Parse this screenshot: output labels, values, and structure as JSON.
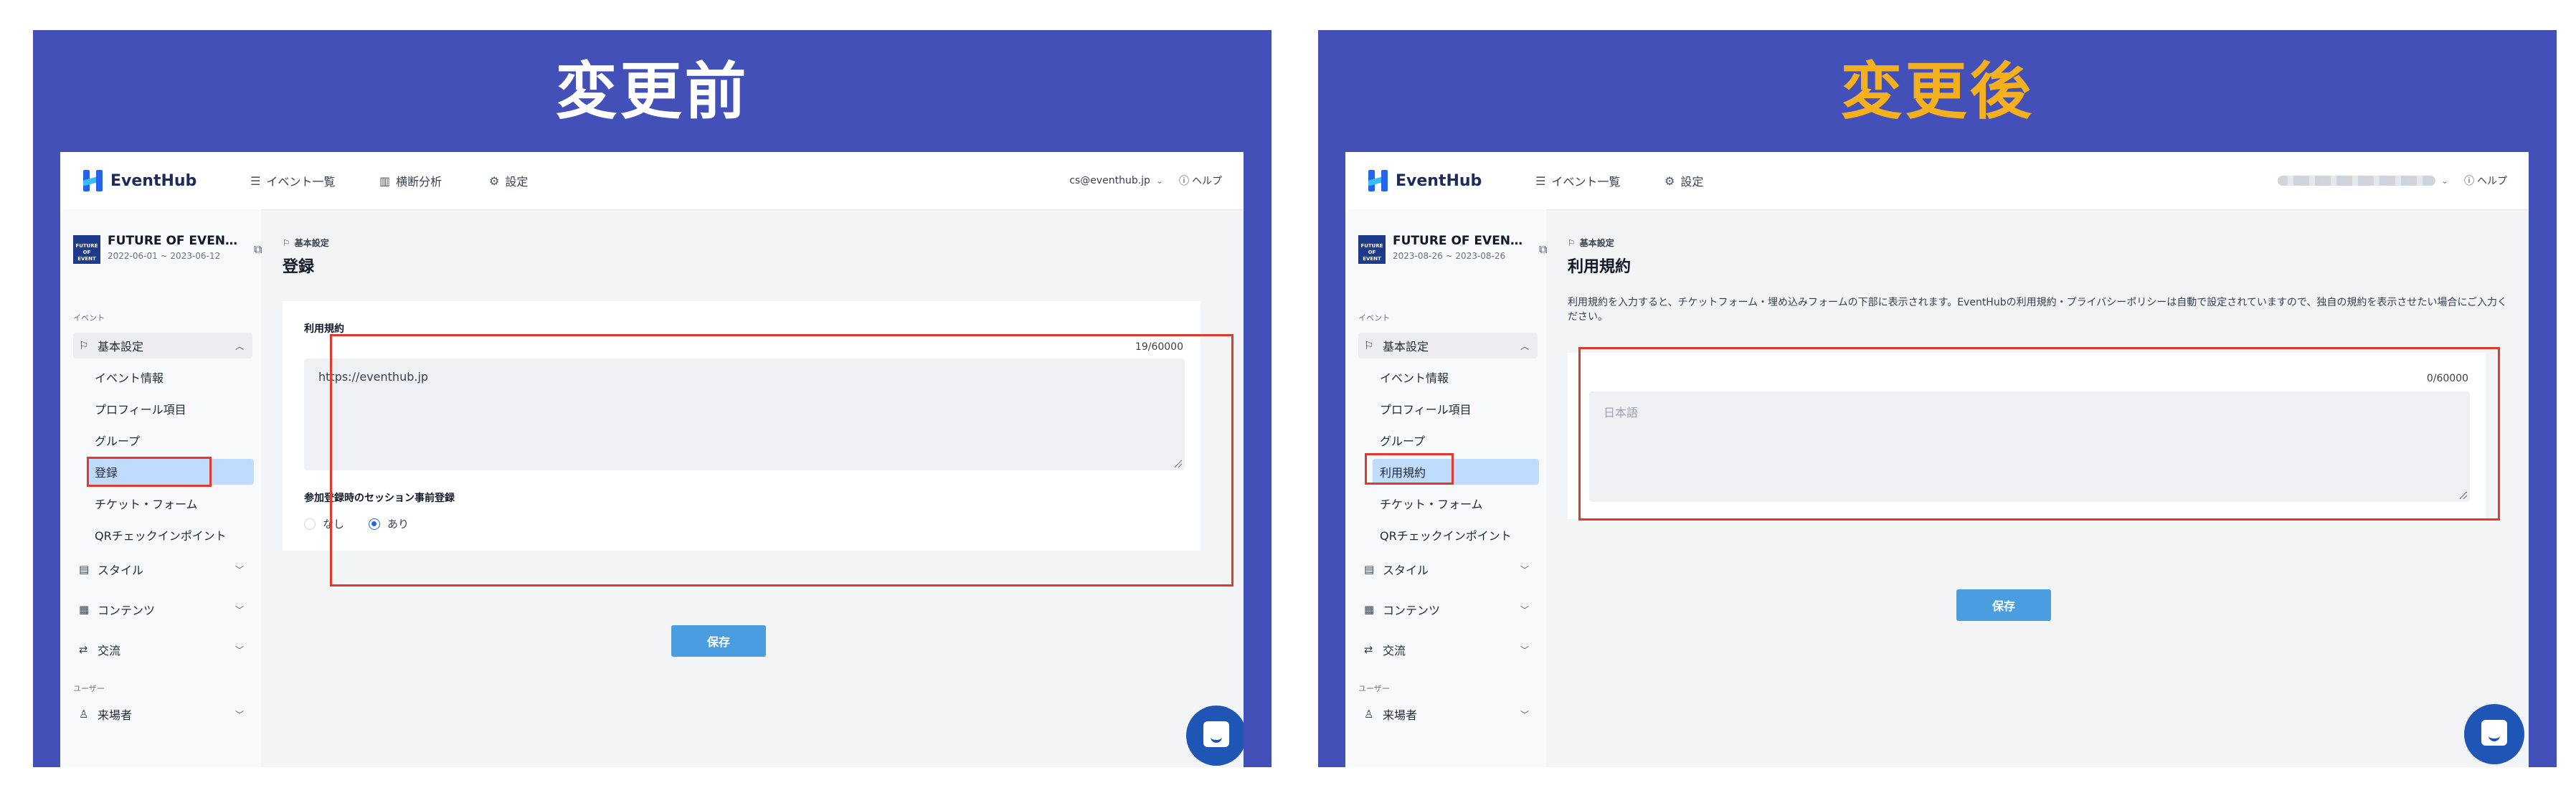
{
  "before": {
    "heading": "変更前",
    "app": {
      "logo": "EventHub",
      "nav": [
        {
          "icon": "list-icon",
          "label": "イベント一覧"
        },
        {
          "icon": "chart-icon",
          "label": "横断分析"
        },
        {
          "icon": "gear-icon",
          "label": "設定"
        }
      ],
      "account": "cs@eventhub.jp",
      "help": "ヘルプ",
      "event": {
        "name": "FUTURE OF EVEN…",
        "dates": "2022-06-01 ~ 2023-06-12",
        "thumb": "FUTURE OF EVENT"
      },
      "sidebar": {
        "section_event": "イベント",
        "group_basic": "基本設定",
        "sub_items": [
          "イベント情報",
          "プロフィール項目",
          "グループ",
          "登録",
          "チケット・フォーム",
          "QRチェックインポイント"
        ],
        "active_index": 3,
        "style": "スタイル",
        "contents": "コンテンツ",
        "exchange": "交流",
        "section_user": "ユーザー",
        "visitors": "来場者"
      },
      "main": {
        "breadcrumb": "基本設定",
        "title": "登録",
        "field_label": "利用規約",
        "counter": "19/60000",
        "textarea_value": "https://eventhub.jp",
        "session_label": "参加登録時のセッション事前登録",
        "radio_none": "なし",
        "radio_yes": "あり",
        "radio_selected": "あり",
        "save": "保存"
      }
    }
  },
  "after": {
    "heading": "変更後",
    "app": {
      "logo": "EventHub",
      "nav": [
        {
          "icon": "list-icon",
          "label": "イベント一覧"
        },
        {
          "icon": "gear-icon",
          "label": "設定"
        }
      ],
      "help": "ヘルプ",
      "event": {
        "name": "FUTURE OF EVEN…",
        "dates": "2023-08-26 ~ 2023-08-26",
        "thumb": "FUTURE OF EVENT"
      },
      "sidebar": {
        "section_event": "イベント",
        "group_basic": "基本設定",
        "sub_items": [
          "イベント情報",
          "プロフィール項目",
          "グループ",
          "利用規約",
          "チケット・フォーム",
          "QRチェックインポイント"
        ],
        "active_index": 3,
        "style": "スタイル",
        "contents": "コンテンツ",
        "exchange": "交流",
        "section_user": "ユーザー",
        "visitors": "来場者"
      },
      "main": {
        "breadcrumb": "基本設定",
        "title": "利用規約",
        "description": "利用規約を入力すると、チケットフォーム・埋め込みフォームの下部に表示されます。EventHubの利用規約・プライバシーポリシーは自動で設定されていますので、独自の規約を表示させたい場合にご入力ください。",
        "counter": "0/60000",
        "textarea_placeholder": "日本語",
        "save": "保存"
      }
    }
  },
  "colors": {
    "panel_bg": "#4350b8",
    "heading_before": "#ffffff",
    "heading_after": "#f5b01f",
    "highlight": "#e03a2d",
    "accent": "#2563eb",
    "save_button": "#4a9ee0",
    "active_item": "#bfdbfe"
  }
}
